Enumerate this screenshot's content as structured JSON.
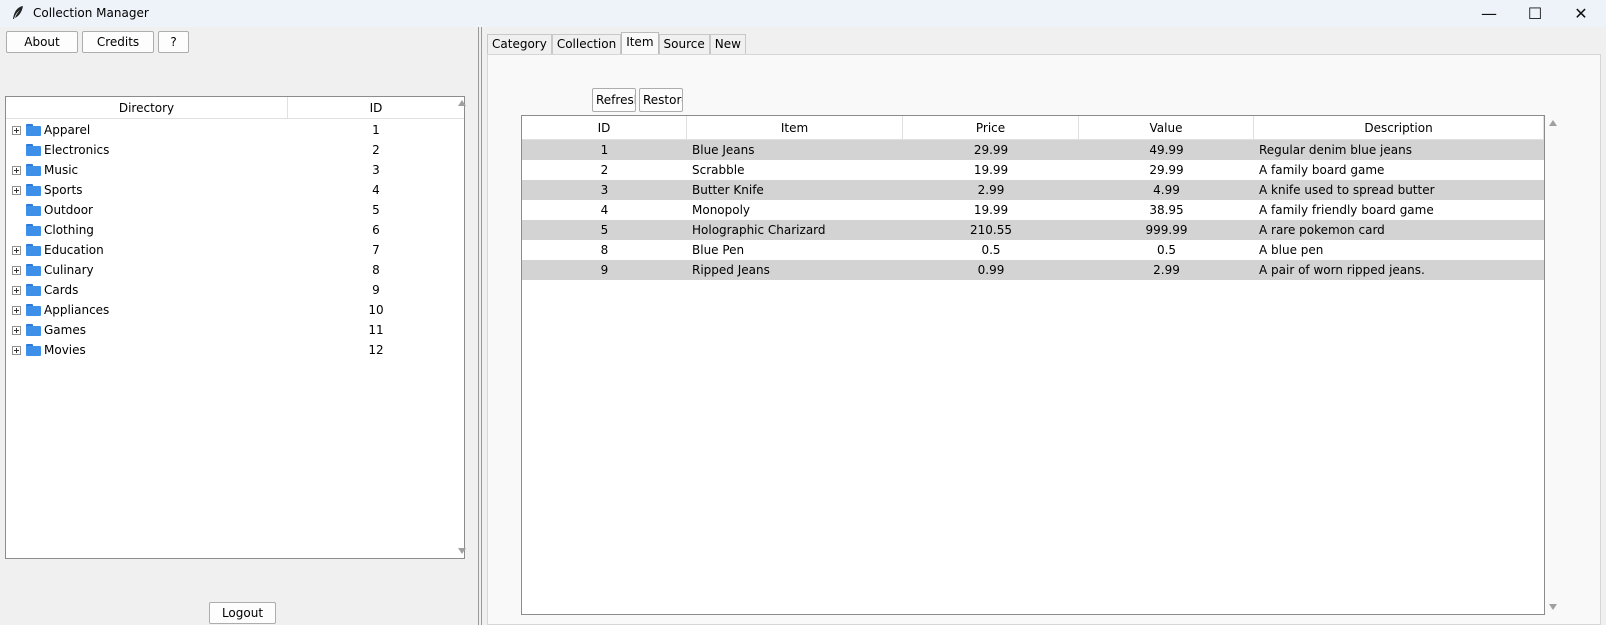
{
  "window": {
    "title": "Collection Manager",
    "minimize_glyph": "—",
    "maximize_glyph": "☐",
    "close_glyph": "✕"
  },
  "left": {
    "about_label": "About",
    "credits_label": "Credits",
    "help_label": "?",
    "logout_label": "Logout",
    "tree_headers": {
      "directory": "Directory",
      "id": "ID"
    },
    "tree_items": [
      {
        "name": "Apparel",
        "id": "1",
        "expandable": true
      },
      {
        "name": "Electronics",
        "id": "2",
        "expandable": false
      },
      {
        "name": "Music",
        "id": "3",
        "expandable": true
      },
      {
        "name": "Sports",
        "id": "4",
        "expandable": true
      },
      {
        "name": "Outdoor",
        "id": "5",
        "expandable": false
      },
      {
        "name": "Clothing",
        "id": "6",
        "expandable": false
      },
      {
        "name": "Education",
        "id": "7",
        "expandable": true
      },
      {
        "name": "Culinary",
        "id": "8",
        "expandable": true
      },
      {
        "name": "Cards",
        "id": "9",
        "expandable": true
      },
      {
        "name": "Appliances",
        "id": "10",
        "expandable": true
      },
      {
        "name": "Games",
        "id": "11",
        "expandable": true
      },
      {
        "name": "Movies",
        "id": "12",
        "expandable": true
      }
    ]
  },
  "right": {
    "tabs": [
      {
        "label": "Category",
        "active": false
      },
      {
        "label": "Collection",
        "active": false
      },
      {
        "label": "Item",
        "active": true
      },
      {
        "label": "Source",
        "active": false
      },
      {
        "label": "New",
        "active": false
      }
    ],
    "refresh_label": "Refresh",
    "restore_label": "Restore",
    "table": {
      "headers": {
        "id": "ID",
        "item": "Item",
        "price": "Price",
        "value": "Value",
        "description": "Description"
      },
      "rows": [
        {
          "id": "1",
          "item": "Blue Jeans",
          "price": "29.99",
          "value": "49.99",
          "description": "Regular denim blue jeans"
        },
        {
          "id": "2",
          "item": "Scrabble",
          "price": "19.99",
          "value": "29.99",
          "description": "A family board game"
        },
        {
          "id": "3",
          "item": "Butter Knife",
          "price": "2.99",
          "value": "4.99",
          "description": "A knife used to spread butter"
        },
        {
          "id": "4",
          "item": "Monopoly",
          "price": "19.99",
          "value": "38.95",
          "description": "A family friendly board game"
        },
        {
          "id": "5",
          "item": "Holographic Charizard",
          "price": "210.55",
          "value": "999.99",
          "description": "A rare pokemon card"
        },
        {
          "id": "8",
          "item": "Blue Pen",
          "price": "0.5",
          "value": "0.5",
          "description": "A blue pen"
        },
        {
          "id": "9",
          "item": "Ripped Jeans",
          "price": "0.99",
          "value": "2.99",
          "description": "A pair of worn ripped jeans."
        }
      ]
    }
  },
  "colors": {
    "folder": "#3d8fe8",
    "row_shade": "#d3d3d3",
    "titlebar": "#eef2f9"
  }
}
